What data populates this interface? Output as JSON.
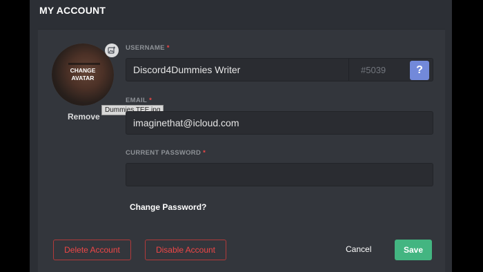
{
  "page": {
    "title": "MY ACCOUNT"
  },
  "avatar": {
    "overlay_label": "CHANGE\nAVATAR",
    "upload_icon": "image-plus-icon",
    "remove_label": "Remove",
    "tooltip": "Dummies TEE.jpg"
  },
  "fields": {
    "username": {
      "label": "USERNAME",
      "required_marker": "*",
      "value": "Discord4Dummies Writer",
      "discriminator": "#5039",
      "help_label": "?"
    },
    "email": {
      "label": "EMAIL",
      "required_marker": "*",
      "value": "imaginethat@icloud.com"
    },
    "current_password": {
      "label": "CURRENT PASSWORD",
      "required_marker": "*",
      "value": ""
    }
  },
  "links": {
    "change_password": "Change Password?"
  },
  "actions": {
    "delete": "Delete Account",
    "disable": "Disable Account",
    "cancel": "Cancel",
    "save": "Save"
  },
  "colors": {
    "background": "#2c2f35",
    "card": "#33363c",
    "danger": "#f04747",
    "save": "#43b581",
    "blurple": "#7289da"
  }
}
